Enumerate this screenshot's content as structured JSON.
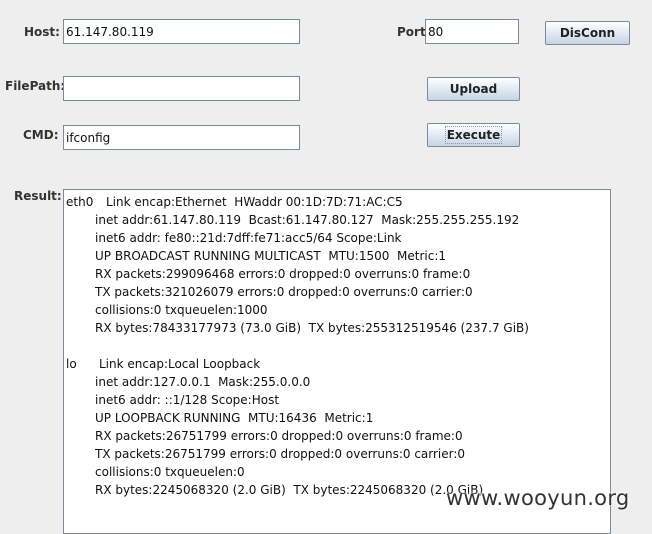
{
  "host": {
    "label": "Host:",
    "value": "61.147.80.119"
  },
  "port": {
    "label": "Port:",
    "value": "80"
  },
  "disconnect_label": "DisConn",
  "filepath": {
    "label": "FilePath:",
    "value": ""
  },
  "upload_label": "Upload",
  "cmd": {
    "label": "CMD:",
    "value": "ifconfig"
  },
  "execute_label": "Execute",
  "result": {
    "label": "Result:",
    "eth0": {
      "iface": "eth0",
      "head": "Link encap:Ethernet  HWaddr 00:1D:7D:71:AC:C5",
      "lines": [
        "inet addr:61.147.80.119  Bcast:61.147.80.127  Mask:255.255.255.192",
        "inet6 addr: fe80::21d:7dff:fe71:acc5/64 Scope:Link",
        "UP BROADCAST RUNNING MULTICAST  MTU:1500  Metric:1",
        "RX packets:299096468 errors:0 dropped:0 overruns:0 frame:0",
        "TX packets:321026079 errors:0 dropped:0 overruns:0 carrier:0",
        "collisions:0 txqueuelen:1000",
        "RX bytes:78433177973 (73.0 GiB)  TX bytes:255312519546 (237.7 GiB)"
      ]
    },
    "lo": {
      "iface": "lo",
      "head": "Link encap:Local Loopback",
      "lines": [
        "inet addr:127.0.0.1  Mask:255.0.0.0",
        "inet6 addr: ::1/128 Scope:Host",
        "UP LOOPBACK RUNNING  MTU:16436  Metric:1",
        "RX packets:26751799 errors:0 dropped:0 overruns:0 frame:0",
        "TX packets:26751799 errors:0 dropped:0 overruns:0 carrier:0",
        "collisions:0 txqueuelen:0",
        "RX bytes:2245068320 (2.0 GiB)  TX bytes:2245068320 (2.0 GiB)"
      ]
    }
  },
  "watermark": "www.wooyun.org"
}
